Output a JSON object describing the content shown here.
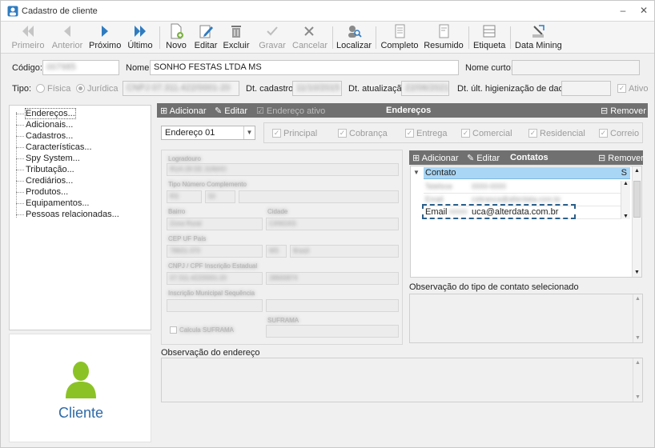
{
  "window": {
    "title": "Cadastro de cliente",
    "minimize": "–",
    "close": "✕"
  },
  "toolbar": {
    "primeiro": "Primeiro",
    "anterior": "Anterior",
    "proximo": "Próximo",
    "ultimo": "Último",
    "novo": "Novo",
    "editar": "Editar",
    "excluir": "Excluir",
    "gravar": "Gravar",
    "cancelar": "Cancelar",
    "localizar": "Localizar",
    "completo": "Completo",
    "resumido": "Resumido",
    "etiqueta": "Etiqueta",
    "data_mining": "Data Mining"
  },
  "form": {
    "codigo_label": "Código:",
    "nome_label": "Nome:",
    "nome_value": "SONHO FESTAS LTDA MS",
    "nome_curto_label": "Nome curto:",
    "tipo_label": "Tipo:",
    "fisica": "Física",
    "juridica": "Jurídica",
    "dt_cadastro_label": "Dt. cadastro:",
    "dt_atualizacao_label": "Dt. atualização:",
    "dt_higienizacao_label": "Dt. últ. higienização de dados:",
    "ativo_label": "Ativo"
  },
  "tree": {
    "items": [
      "Endereços...",
      "Adicionais...",
      "Cadastros...",
      "Características...",
      "Spy System...",
      "Tributação...",
      "Crediários...",
      "Produtos...",
      "Equipamentos...",
      "Pessoas relacionadas..."
    ]
  },
  "cliente_label": "Cliente",
  "enderecos": {
    "adicionar": "Adicionar",
    "editar": "Editar",
    "ativo": "Endereço ativo",
    "title": "Endereços",
    "remover": "Remover",
    "combo_value": "Endereço 01",
    "checks": [
      "Principal",
      "Cobrança",
      "Entrega",
      "Comercial",
      "Residencial",
      "Correio"
    ],
    "observacao_label": "Observação do endereço"
  },
  "contatos": {
    "adicionar": "Adicionar",
    "editar": "Editar",
    "title": "Contatos",
    "remover": "Remover",
    "col_contato": "Contato",
    "col_s": "S",
    "email_label": "Email",
    "email_value": "uca@alterdata.com.br",
    "observacao_label": "Observação do tipo de contato selecionado"
  },
  "colors": {
    "header": "#707070",
    "selection": "#a9d6f5",
    "accent": "#2e6aa8",
    "avatar": "#8bc326"
  }
}
